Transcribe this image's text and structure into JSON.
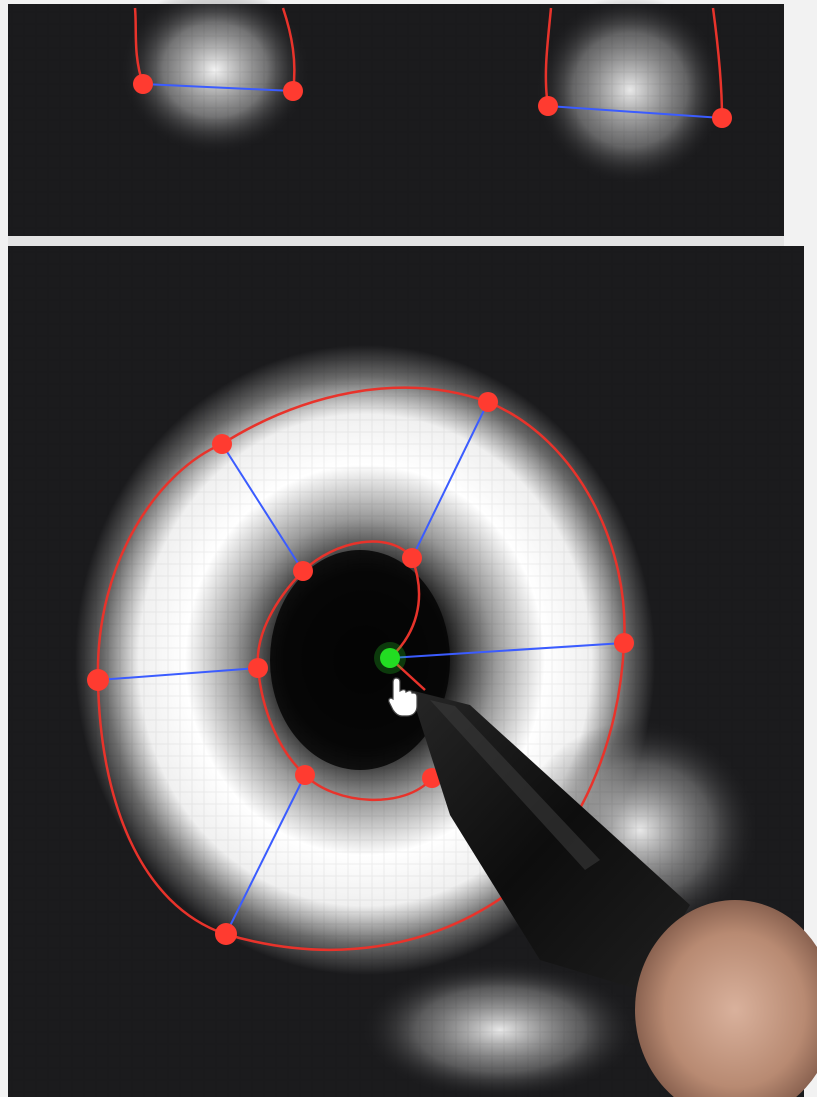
{
  "app": {
    "panels": [
      "top-viewport",
      "main-viewport"
    ],
    "colors": {
      "background": "#f2f2f2",
      "viewport": "#1b1b1d",
      "divider": "#e4e4e4",
      "contour": "#e8332b",
      "control_point": "#ff3b30",
      "spoke": "#3b5cff",
      "center_point": "#22dd22",
      "cursor": "#ffffff",
      "stylus": "#111111"
    },
    "icons": {
      "cursor": "hand-pointer-icon",
      "control_point": "circle-handle-icon",
      "center_point": "center-handle-icon"
    },
    "labels": {}
  }
}
